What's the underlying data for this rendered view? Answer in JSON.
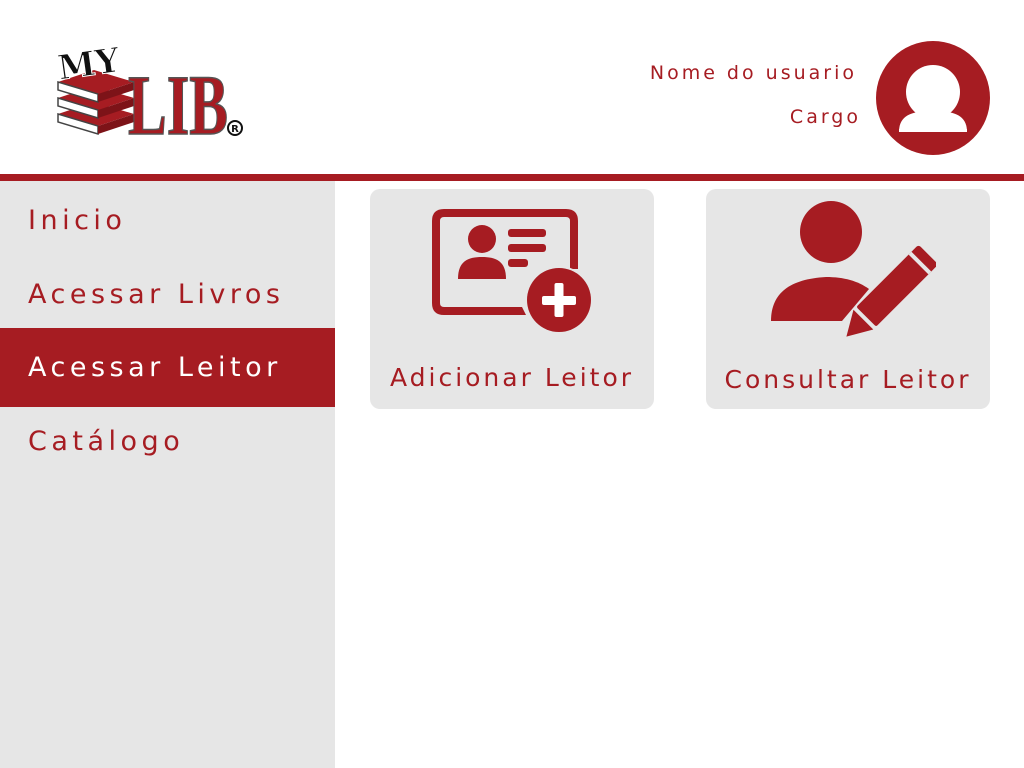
{
  "header": {
    "logo_text": "MYLIB",
    "logo_top_text": "MY",
    "logo_main_text": "LIB",
    "logo_mark": "®",
    "user_name": "Nome do usuario",
    "user_role": "Cargo",
    "avatar_icon": "user-silhouette-icon"
  },
  "sidebar": {
    "items": [
      {
        "label": "Inicio",
        "active": false
      },
      {
        "label": "Acessar Livros",
        "active": false
      },
      {
        "label": "Acessar Leitor",
        "active": true
      },
      {
        "label": "Catálogo",
        "active": false
      }
    ]
  },
  "main": {
    "cards": [
      {
        "label": "Adicionar Leitor",
        "icon": "add-reader-card-icon"
      },
      {
        "label": "Consultar Leitor",
        "icon": "edit-user-icon"
      }
    ]
  },
  "colors": {
    "accent": "#a61c22",
    "panel": "#e6e6e6",
    "background": "#ffffff"
  }
}
